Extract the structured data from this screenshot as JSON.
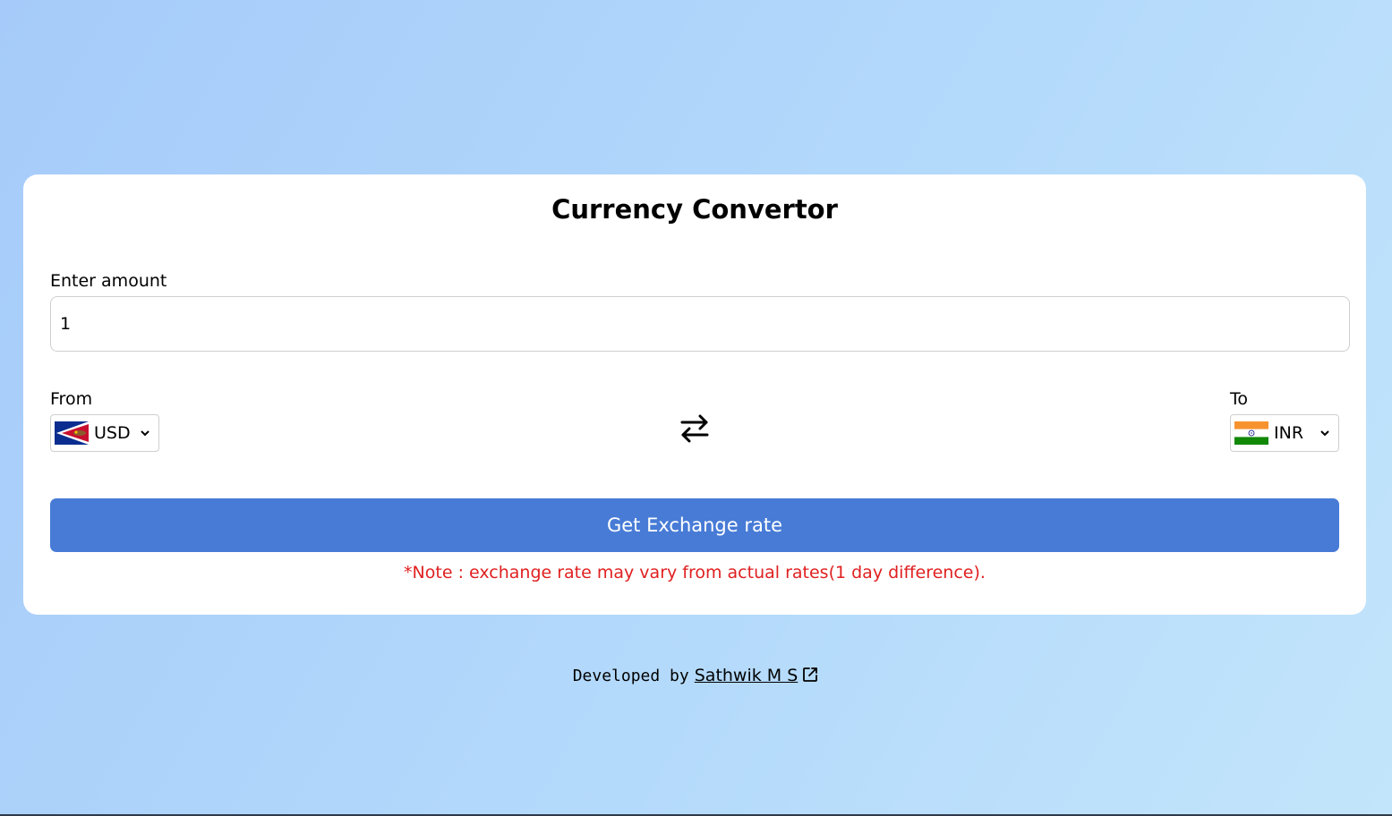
{
  "card": {
    "title": "Currency Convertor"
  },
  "amount": {
    "label": "Enter amount",
    "value": "1"
  },
  "from": {
    "label": "From",
    "currency": "USD",
    "flag_icon": "american-samoa-flag-icon"
  },
  "to": {
    "label": "To",
    "currency": "INR",
    "flag_icon": "india-flag-icon"
  },
  "swap_icon": "swap-arrows-icon",
  "button": {
    "label": "Get Exchange rate"
  },
  "note": "*Note : exchange rate may vary from actual rates(1 day difference).",
  "footer": {
    "developed_by": "Developed by",
    "author": "Sathwik M S",
    "link_icon": "external-link-icon"
  },
  "colors": {
    "button": "#477bd6",
    "note": "#e02020",
    "card": "#ffffff"
  }
}
